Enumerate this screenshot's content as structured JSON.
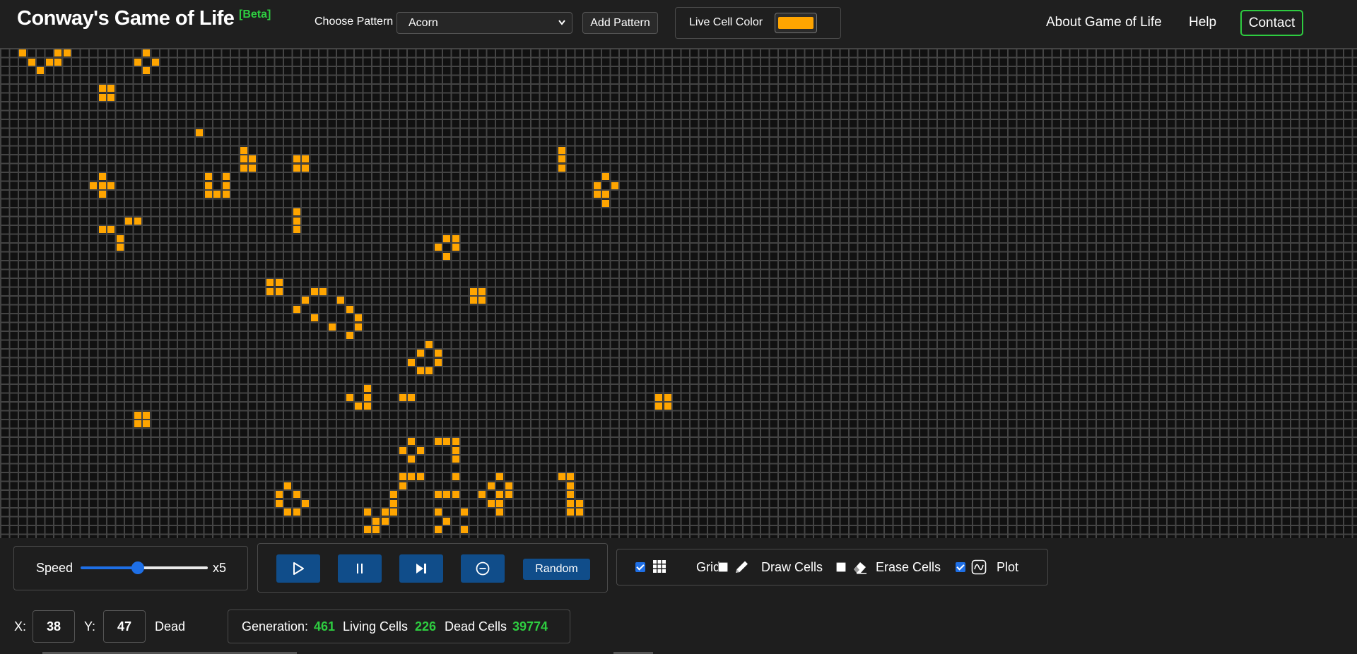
{
  "header": {
    "title": "Conway's Game of Life",
    "badge": "[Beta]",
    "pattern_label": "Choose Pattern",
    "pattern_selected": "Acorn",
    "add_pattern_label": "Add Pattern",
    "live_cell_color_label": "Live Cell Color",
    "live_cell_color": "#ffa500",
    "nav": {
      "about": "About Game of Life",
      "help": "Help",
      "contact": "Contact"
    }
  },
  "board": {
    "columns": 154,
    "rows": 56,
    "cell_color": "#ffa500",
    "grid_color": "#444444",
    "dead_color": "#111111",
    "live_cells": [
      [
        2,
        0
      ],
      [
        3,
        1
      ],
      [
        4,
        2
      ],
      [
        5,
        1
      ],
      [
        6,
        0
      ],
      [
        6,
        1
      ],
      [
        7,
        0
      ],
      [
        15,
        1
      ],
      [
        16,
        0
      ],
      [
        16,
        2
      ],
      [
        17,
        1
      ],
      [
        11,
        4
      ],
      [
        12,
        4
      ],
      [
        11,
        5
      ],
      [
        12,
        5
      ],
      [
        22,
        9
      ],
      [
        27,
        11
      ],
      [
        27,
        12
      ],
      [
        28,
        12
      ],
      [
        27,
        13
      ],
      [
        28,
        13
      ],
      [
        33,
        12
      ],
      [
        34,
        12
      ],
      [
        33,
        13
      ],
      [
        34,
        13
      ],
      [
        63,
        11
      ],
      [
        63,
        12
      ],
      [
        63,
        13
      ],
      [
        10,
        15
      ],
      [
        11,
        14
      ],
      [
        11,
        15
      ],
      [
        12,
        15
      ],
      [
        11,
        16
      ],
      [
        23,
        14
      ],
      [
        23,
        15
      ],
      [
        23,
        16
      ],
      [
        24,
        16
      ],
      [
        25,
        16
      ],
      [
        25,
        15
      ],
      [
        25,
        14
      ],
      [
        67,
        15
      ],
      [
        68,
        14
      ],
      [
        68,
        16
      ],
      [
        69,
        15
      ],
      [
        68,
        17
      ],
      [
        67,
        16
      ],
      [
        33,
        18
      ],
      [
        33,
        19
      ],
      [
        33,
        20
      ],
      [
        14,
        19
      ],
      [
        15,
        19
      ],
      [
        11,
        20
      ],
      [
        12,
        20
      ],
      [
        13,
        21
      ],
      [
        13,
        22
      ],
      [
        50,
        21
      ],
      [
        51,
        21
      ],
      [
        49,
        22
      ],
      [
        51,
        22
      ],
      [
        50,
        23
      ],
      [
        30,
        26
      ],
      [
        31,
        26
      ],
      [
        30,
        27
      ],
      [
        31,
        27
      ],
      [
        53,
        27
      ],
      [
        54,
        27
      ],
      [
        53,
        28
      ],
      [
        54,
        28
      ],
      [
        35,
        27
      ],
      [
        36,
        27
      ],
      [
        34,
        28
      ],
      [
        38,
        28
      ],
      [
        33,
        29
      ],
      [
        39,
        29
      ],
      [
        35,
        30
      ],
      [
        40,
        30
      ],
      [
        37,
        31
      ],
      [
        40,
        31
      ],
      [
        39,
        32
      ],
      [
        48,
        33
      ],
      [
        47,
        34
      ],
      [
        49,
        34
      ],
      [
        46,
        35
      ],
      [
        49,
        35
      ],
      [
        47,
        36
      ],
      [
        48,
        36
      ],
      [
        41,
        38
      ],
      [
        39,
        39
      ],
      [
        41,
        39
      ],
      [
        40,
        40
      ],
      [
        41,
        40
      ],
      [
        45,
        39
      ],
      [
        46,
        39
      ],
      [
        74,
        39
      ],
      [
        75,
        39
      ],
      [
        74,
        40
      ],
      [
        75,
        40
      ],
      [
        15,
        41
      ],
      [
        16,
        41
      ],
      [
        15,
        42
      ],
      [
        16,
        42
      ],
      [
        46,
        44
      ],
      [
        49,
        44
      ],
      [
        50,
        44
      ],
      [
        51,
        44
      ],
      [
        45,
        45
      ],
      [
        47,
        45
      ],
      [
        51,
        45
      ],
      [
        46,
        46
      ],
      [
        51,
        46
      ],
      [
        45,
        48
      ],
      [
        46,
        48
      ],
      [
        47,
        48
      ],
      [
        51,
        48
      ],
      [
        56,
        48
      ],
      [
        55,
        49
      ],
      [
        57,
        49
      ],
      [
        63,
        48
      ],
      [
        64,
        48
      ],
      [
        64,
        49
      ],
      [
        32,
        49
      ],
      [
        31,
        50
      ],
      [
        33,
        50
      ],
      [
        45,
        49
      ],
      [
        44,
        50
      ],
      [
        49,
        50
      ],
      [
        50,
        50
      ],
      [
        51,
        50
      ],
      [
        54,
        50
      ],
      [
        56,
        50
      ],
      [
        57,
        50
      ],
      [
        64,
        50
      ],
      [
        65,
        51
      ],
      [
        64,
        51
      ],
      [
        31,
        51
      ],
      [
        34,
        51
      ],
      [
        44,
        51
      ],
      [
        55,
        51
      ],
      [
        56,
        51
      ],
      [
        64,
        52
      ],
      [
        65,
        52
      ],
      [
        32,
        52
      ],
      [
        33,
        52
      ],
      [
        41,
        52
      ],
      [
        43,
        52
      ],
      [
        44,
        52
      ],
      [
        49,
        52
      ],
      [
        52,
        52
      ],
      [
        56,
        52
      ],
      [
        42,
        53
      ],
      [
        43,
        53
      ],
      [
        50,
        53
      ],
      [
        41,
        54
      ],
      [
        42,
        54
      ],
      [
        49,
        54
      ],
      [
        52,
        54
      ]
    ]
  },
  "controls": {
    "speed_label": "Speed",
    "speed_fraction": 0.45,
    "speed_value": "x5",
    "random_label": "Random",
    "options": [
      {
        "label": "Grid",
        "checked": true
      },
      {
        "label": "Draw Cells",
        "checked": false
      },
      {
        "label": "Erase Cells",
        "checked": false
      },
      {
        "label": "Plot",
        "checked": true
      }
    ]
  },
  "status": {
    "x_label": "X:",
    "x_value": "38",
    "y_label": "Y:",
    "y_value": "47",
    "cell_state": "Dead",
    "generation_label": "Generation:",
    "generation": "461",
    "living_label": "Living Cells",
    "living": "226",
    "dead_label": "Dead Cells",
    "dead": "39774"
  }
}
